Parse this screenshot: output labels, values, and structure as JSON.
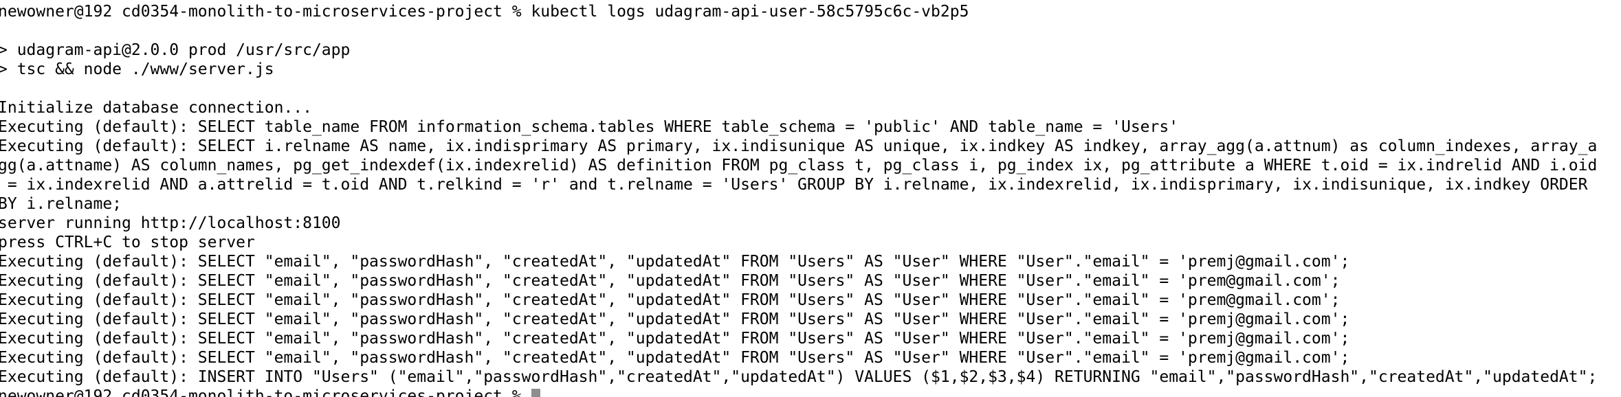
{
  "terminal": {
    "lines": [
      "newowner@192 cd0354-monolith-to-microservices-project % kubectl logs udagram-api-user-58c5795c6c-vb2p5",
      "",
      "> udagram-api@2.0.0 prod /usr/src/app",
      "> tsc && node ./www/server.js",
      "",
      "Initialize database connection...",
      "Executing (default): SELECT table_name FROM information_schema.tables WHERE table_schema = 'public' AND table_name = 'Users'",
      "Executing (default): SELECT i.relname AS name, ix.indisprimary AS primary, ix.indisunique AS unique, ix.indkey AS indkey, array_agg(a.attnum) as column_indexes, array_a",
      "gg(a.attname) AS column_names, pg_get_indexdef(ix.indexrelid) AS definition FROM pg_class t, pg_class i, pg_index ix, pg_attribute a WHERE t.oid = ix.indrelid AND i.oid",
      " = ix.indexrelid AND a.attrelid = t.oid AND t.relkind = 'r' and t.relname = 'Users' GROUP BY i.relname, ix.indexrelid, ix.indisprimary, ix.indisunique, ix.indkey ORDER",
      "BY i.relname;",
      "server running http://localhost:8100",
      "press CTRL+C to stop server",
      "Executing (default): SELECT \"email\", \"passwordHash\", \"createdAt\", \"updatedAt\" FROM \"Users\" AS \"User\" WHERE \"User\".\"email\" = 'premj@gmail.com';",
      "Executing (default): SELECT \"email\", \"passwordHash\", \"createdAt\", \"updatedAt\" FROM \"Users\" AS \"User\" WHERE \"User\".\"email\" = 'prem@gmail.com';",
      "Executing (default): SELECT \"email\", \"passwordHash\", \"createdAt\", \"updatedAt\" FROM \"Users\" AS \"User\" WHERE \"User\".\"email\" = 'prem@gmail.com';",
      "Executing (default): SELECT \"email\", \"passwordHash\", \"createdAt\", \"updatedAt\" FROM \"Users\" AS \"User\" WHERE \"User\".\"email\" = 'premj@gmail.com';",
      "Executing (default): SELECT \"email\", \"passwordHash\", \"createdAt\", \"updatedAt\" FROM \"Users\" AS \"User\" WHERE \"User\".\"email\" = 'premj@gmail.com';",
      "Executing (default): SELECT \"email\", \"passwordHash\", \"createdAt\", \"updatedAt\" FROM \"Users\" AS \"User\" WHERE \"User\".\"email\" = 'premj@gmail.com';",
      "Executing (default): INSERT INTO \"Users\" (\"email\",\"passwordHash\",\"createdAt\",\"updatedAt\") VALUES ($1,$2,$3,$4) RETURNING \"email\",\"passwordHash\",\"createdAt\",\"updatedAt\";",
      "newowner@192 cd0354-monolith-to-microservices-project % "
    ]
  }
}
